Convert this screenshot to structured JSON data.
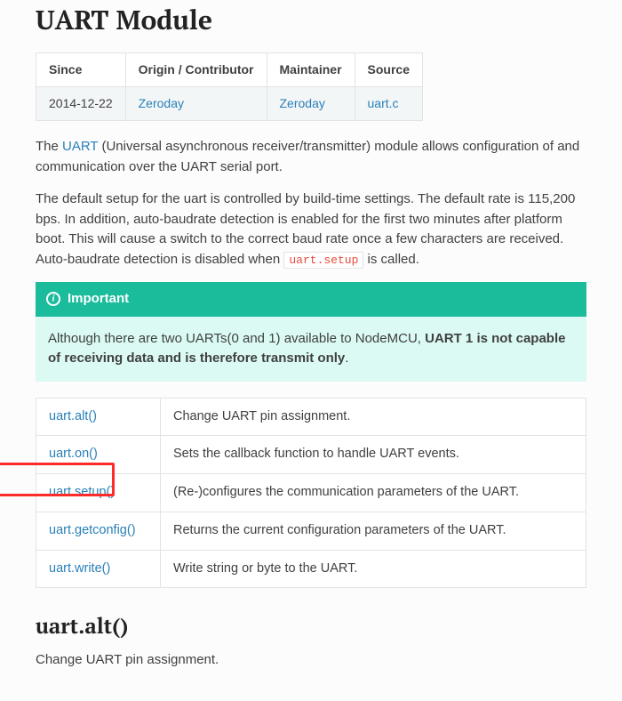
{
  "title": "UART Module",
  "meta": {
    "headers": [
      "Since",
      "Origin / Contributor",
      "Maintainer",
      "Source"
    ],
    "since": "2014-12-22",
    "origin": "Zeroday",
    "maintainer": "Zeroday",
    "source": "uart.c"
  },
  "intro": {
    "pre": "The ",
    "link": "UART",
    "post": " (Universal asynchronous receiver/transmitter) module allows configuration of and communication over the UART serial port."
  },
  "paragraph2": {
    "pre": "The default setup for the uart is controlled by build-time settings. The default rate is 115,200 bps. In addition, auto-baudrate detection is enabled for the first two minutes after platform boot. This will cause a switch to the correct baud rate once a few characters are received. Auto-baudrate detection is disabled when ",
    "code": "uart.setup",
    "post": " is called."
  },
  "admonition": {
    "title": "Important",
    "body_pre": "Although there are two UARTs(0 and 1) available to NodeMCU, ",
    "body_bold": "UART 1 is not capable of receiving data and is therefore transmit only",
    "body_post": "."
  },
  "api": [
    {
      "fn": "uart.alt()",
      "desc": "Change UART pin assignment."
    },
    {
      "fn": "uart.on()",
      "desc": "Sets the callback function to handle UART events."
    },
    {
      "fn": "uart.setup()",
      "desc": "(Re-)configures the communication parameters of the UART."
    },
    {
      "fn": "uart.getconfig()",
      "desc": "Returns the current configuration parameters of the UART."
    },
    {
      "fn": "uart.write()",
      "desc": "Write string or byte to the UART."
    }
  ],
  "section2": {
    "title": "uart.alt()",
    "desc": "Change UART pin assignment."
  }
}
